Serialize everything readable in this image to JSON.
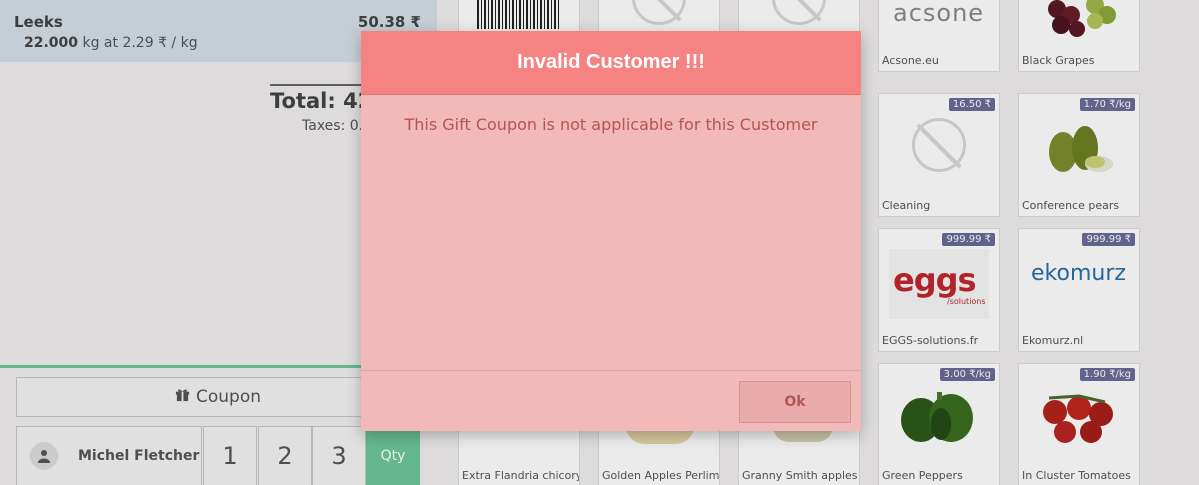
{
  "order": {
    "line": {
      "name": "Leeks",
      "price": "50.38 ₹",
      "qty": "22.000",
      "detail": "kg at 2.29 ₹ / kg"
    },
    "total": "Total: 427",
    "taxes": "Taxes: 0.0"
  },
  "controls": {
    "coupon_label": "Coupon",
    "customer_name": "Michel Fletcher",
    "numpad": [
      "1",
      "2",
      "3"
    ],
    "qty_label": "Qty"
  },
  "products": [
    {
      "name": "",
      "price": ""
    },
    {
      "name": "",
      "price": ""
    },
    {
      "name": "",
      "price": ""
    },
    {
      "name": "Acsone.eu",
      "price": "",
      "logo_text": "acsone"
    },
    {
      "name": "Black Grapes",
      "price": ""
    },
    {
      "name": "Cleaning",
      "price": "16.50 ₹"
    },
    {
      "name": "Conference pears",
      "price": "1.70 ₹/kg"
    },
    {
      "name": "EGGS-solutions.fr",
      "price": "999.99 ₹",
      "logo_text": "eggs",
      "logo_sub": "/solutions"
    },
    {
      "name": "Ekomurz.nl",
      "price": "999.99 ₹",
      "logo_text": "ekomurz"
    },
    {
      "name": "Extra Flandria chicory",
      "price": ""
    },
    {
      "name": "Golden Apples Perlim",
      "price": ""
    },
    {
      "name": "Granny Smith apples",
      "price": ""
    },
    {
      "name": "Green Peppers",
      "price": "3.00 ₹/kg"
    },
    {
      "name": "In Cluster Tomatoes",
      "price": "1.90 ₹/kg"
    }
  ],
  "modal": {
    "title": "Invalid Customer !!!",
    "message": "This Gift Coupon is not applicable for this Customer",
    "ok_label": "Ok"
  },
  "colors": {
    "modal_header": "#f48382",
    "modal_body": "#f2b9b9",
    "accent_green": "#6ec89b",
    "price_tag": "#6b6b99"
  }
}
